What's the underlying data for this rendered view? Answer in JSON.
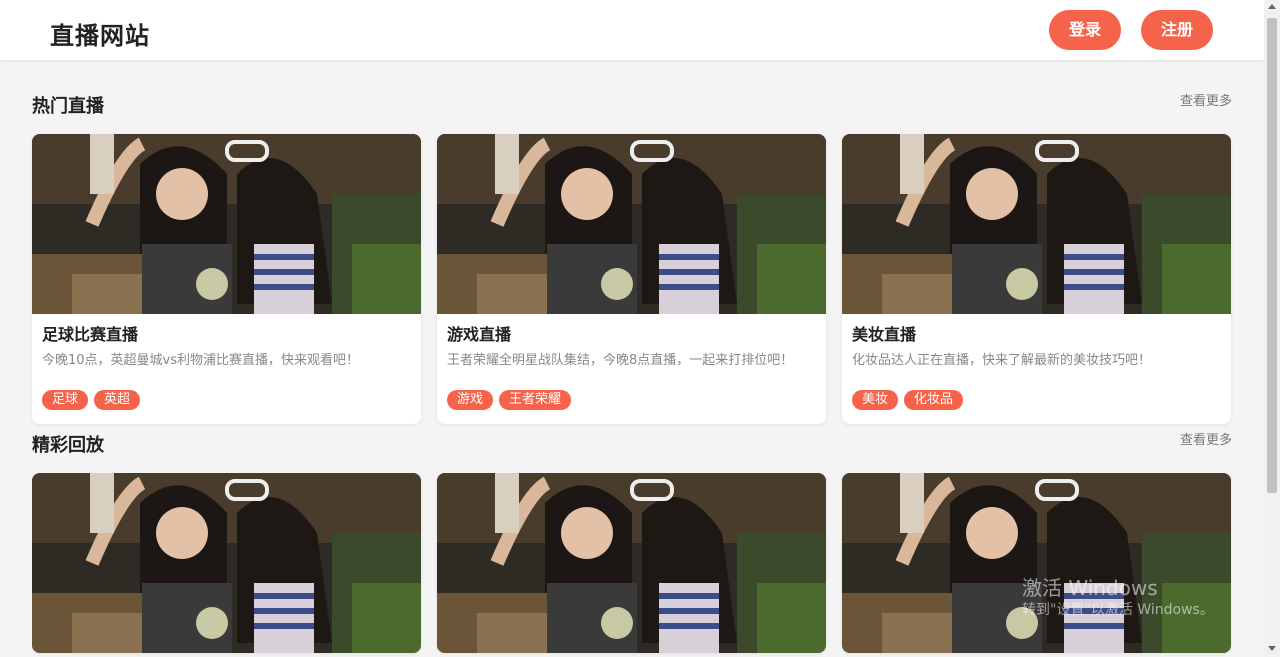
{
  "header": {
    "logo": "直播网站",
    "login_label": "登录",
    "register_label": "注册"
  },
  "sections": [
    {
      "title": "热门直播",
      "more_label": "查看更多",
      "cards": [
        {
          "title": "足球比赛直播",
          "desc": "今晚10点，英超曼城vs利物浦比赛直播，快来观看吧！",
          "tags": [
            "足球",
            "英超"
          ]
        },
        {
          "title": "游戏直播",
          "desc": "王者荣耀全明星战队集结，今晚8点直播，一起来打排位吧！",
          "tags": [
            "游戏",
            "王者荣耀"
          ]
        },
        {
          "title": "美妆直播",
          "desc": "化妆品达人正在直播，快来了解最新的美妆技巧吧！",
          "tags": [
            "美妆",
            "化妆品"
          ]
        }
      ]
    },
    {
      "title": "精彩回放",
      "more_label": "查看更多",
      "cards": [
        {
          "title": "",
          "desc": "",
          "tags": []
        },
        {
          "title": "",
          "desc": "",
          "tags": []
        },
        {
          "title": "",
          "desc": "",
          "tags": []
        }
      ]
    }
  ],
  "watermark": {
    "line1": "激活 Windows",
    "line2": "转到\"设置\"以激活 Windows。"
  },
  "colors": {
    "accent": "#f6634b",
    "background": "#f4f4f4"
  }
}
